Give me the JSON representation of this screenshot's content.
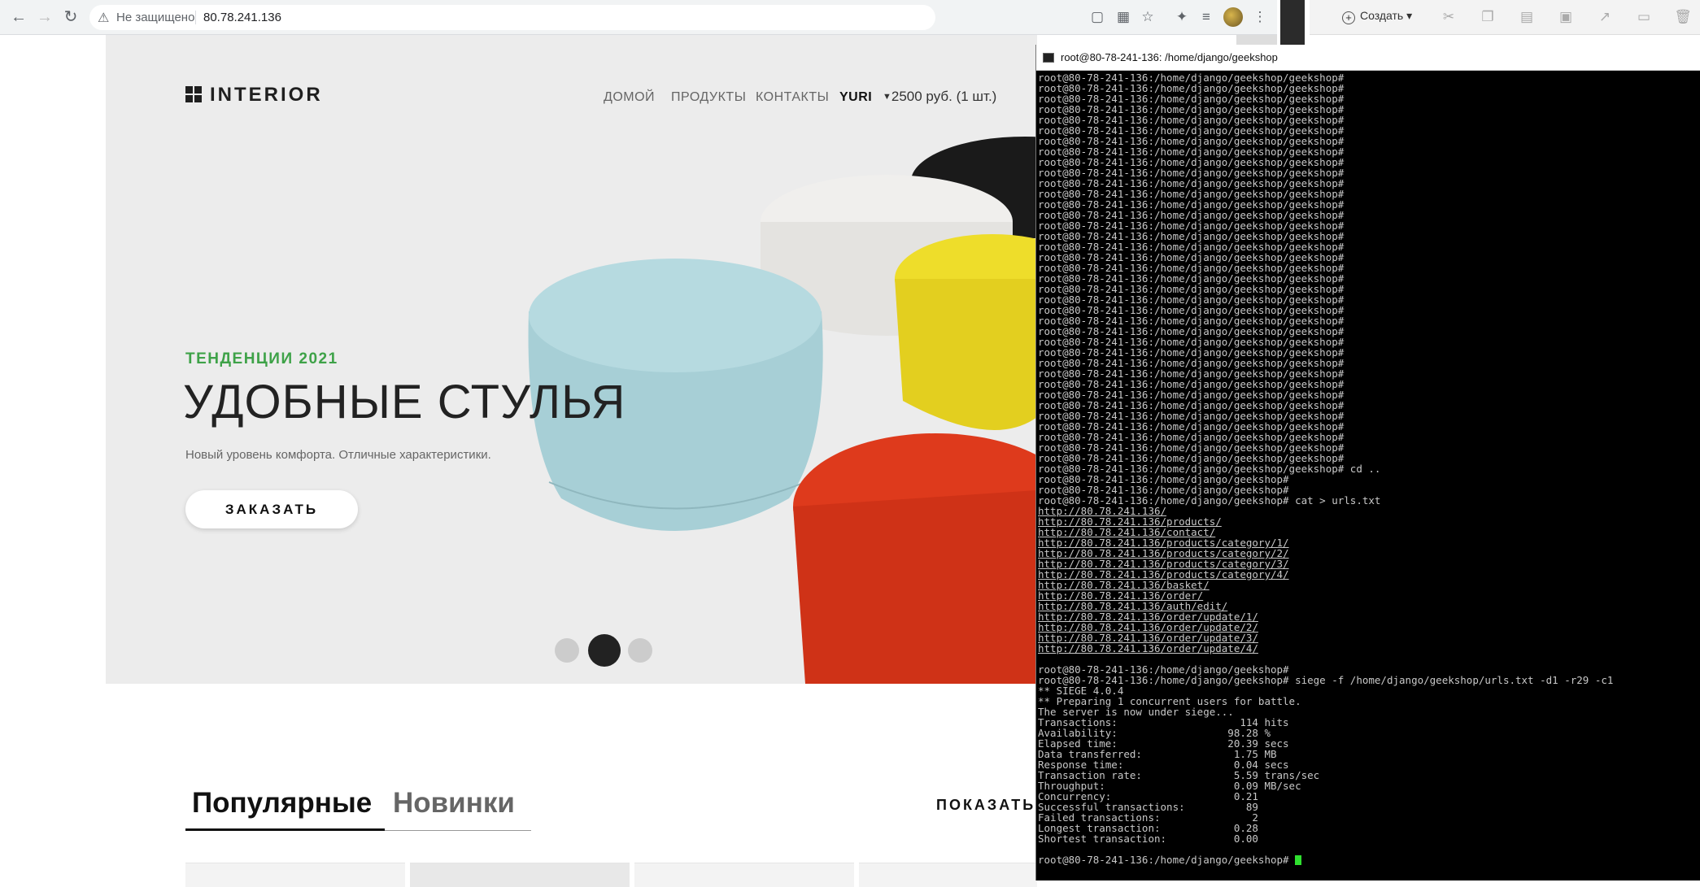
{
  "browser": {
    "insecure_label": "Не защищено",
    "url": "80.78.241.136"
  },
  "office": {
    "create_label": "Создать"
  },
  "site": {
    "logo": "INTERIOR",
    "menu": [
      "ДОМОЙ",
      "ПРОДУКТЫ",
      "КОНТАКТЫ",
      "YURI"
    ],
    "basket": "2500 руб. (1 шт.)",
    "trend": "ТЕНДЕНЦИИ 2021",
    "hero_title": "УДОБНЫЕ СТУЛЬЯ",
    "hero_sub": "Новый уровень комфорта. Отличные характеристики.",
    "order_button": "ЗАКАЗАТЬ",
    "tab_popular": "Популярные",
    "tab_new": "Новинки",
    "show_all": "ПОКАЗАТЬ",
    "colors": {
      "accent_green": "#3ea248",
      "hero_bg": "#ececec"
    }
  },
  "terminal": {
    "title": "root@80-78-241-136: /home/django/geekshop",
    "prompt_lines": [
      "root@80-78-241-136:/home/django/geekshop/geekshop#",
      "root@80-78-241-136:/home/django/geekshop/geekshop#",
      "root@80-78-241-136:/home/django/geekshop/geekshop#",
      "root@80-78-241-136:/home/django/geekshop/geekshop#",
      "root@80-78-241-136:/home/django/geekshop/geekshop#",
      "root@80-78-241-136:/home/django/geekshop/geekshop#",
      "root@80-78-241-136:/home/django/geekshop/geekshop#",
      "root@80-78-241-136:/home/django/geekshop/geekshop#",
      "root@80-78-241-136:/home/django/geekshop/geekshop#",
      "root@80-78-241-136:/home/django/geekshop/geekshop#",
      "root@80-78-241-136:/home/django/geekshop/geekshop#",
      "root@80-78-241-136:/home/django/geekshop/geekshop#",
      "root@80-78-241-136:/home/django/geekshop/geekshop#",
      "root@80-78-241-136:/home/django/geekshop/geekshop#",
      "root@80-78-241-136:/home/django/geekshop/geekshop#",
      "root@80-78-241-136:/home/django/geekshop/geekshop#",
      "root@80-78-241-136:/home/django/geekshop/geekshop#",
      "root@80-78-241-136:/home/django/geekshop/geekshop#",
      "root@80-78-241-136:/home/django/geekshop/geekshop#",
      "root@80-78-241-136:/home/django/geekshop/geekshop#",
      "root@80-78-241-136:/home/django/geekshop/geekshop#",
      "root@80-78-241-136:/home/django/geekshop/geekshop#",
      "root@80-78-241-136:/home/django/geekshop/geekshop#",
      "root@80-78-241-136:/home/django/geekshop/geekshop#",
      "root@80-78-241-136:/home/django/geekshop/geekshop#",
      "root@80-78-241-136:/home/django/geekshop/geekshop#",
      "root@80-78-241-136:/home/django/geekshop/geekshop#",
      "root@80-78-241-136:/home/django/geekshop/geekshop#",
      "root@80-78-241-136:/home/django/geekshop/geekshop#",
      "root@80-78-241-136:/home/django/geekshop/geekshop#",
      "root@80-78-241-136:/home/django/geekshop/geekshop#",
      "root@80-78-241-136:/home/django/geekshop/geekshop#",
      "root@80-78-241-136:/home/django/geekshop/geekshop#",
      "root@80-78-241-136:/home/django/geekshop/geekshop#",
      "root@80-78-241-136:/home/django/geekshop/geekshop#",
      "root@80-78-241-136:/home/django/geekshop/geekshop#",
      "root@80-78-241-136:/home/django/geekshop/geekshop#",
      "root@80-78-241-136:/home/django/geekshop/geekshop# cd ..",
      "root@80-78-241-136:/home/django/geekshop#",
      "root@80-78-241-136:/home/django/geekshop#",
      "root@80-78-241-136:/home/django/geekshop# cat > urls.txt"
    ],
    "urls": [
      "http://80.78.241.136/",
      "http://80.78.241.136/products/",
      "http://80.78.241.136/contact/",
      "http://80.78.241.136/products/category/1/",
      "http://80.78.241.136/products/category/2/",
      "http://80.78.241.136/products/category/3/",
      "http://80.78.241.136/products/category/4/",
      "http://80.78.241.136/basket/",
      "http://80.78.241.136/order/",
      "http://80.78.241.136/auth/edit/",
      "http://80.78.241.136/order/update/1/",
      "http://80.78.241.136/order/update/2/",
      "http://80.78.241.136/order/update/3/",
      "http://80.78.241.136/order/update/4/"
    ],
    "siege_lines": [
      "",
      "root@80-78-241-136:/home/django/geekshop#",
      "root@80-78-241-136:/home/django/geekshop# siege -f /home/django/geekshop/urls.txt -d1 -r29 -c1",
      "** SIEGE 4.0.4",
      "** Preparing 1 concurrent users for battle.",
      "The server is now under siege...",
      "Transactions:                    114 hits",
      "Availability:                  98.28 %",
      "Elapsed time:                  20.39 secs",
      "Data transferred:               1.75 MB",
      "Response time:                  0.04 secs",
      "Transaction rate:               5.59 trans/sec",
      "Throughput:                     0.09 MB/sec",
      "Concurrency:                    0.21",
      "Successful transactions:          89",
      "Failed transactions:               2",
      "Longest transaction:            0.28",
      "Shortest transaction:           0.00",
      ""
    ],
    "final_prompt": "root@80-78-241-136:/home/django/geekshop# "
  }
}
